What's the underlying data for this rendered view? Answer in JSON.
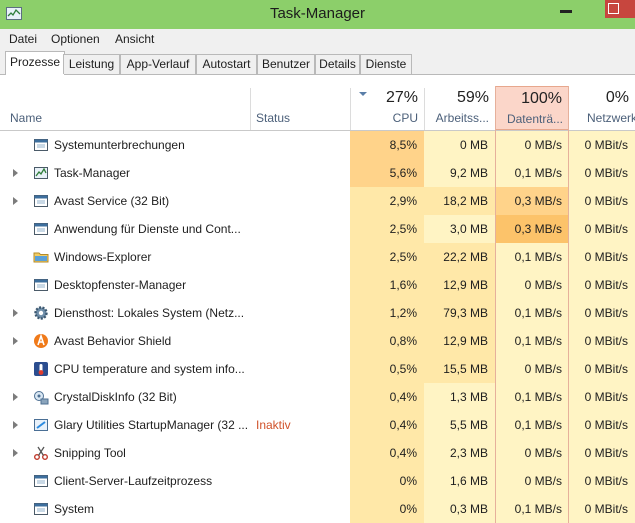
{
  "window": {
    "title": "Task-Manager"
  },
  "menu": [
    "Datei",
    "Optionen",
    "Ansicht"
  ],
  "tabs": [
    "Prozesse",
    "Leistung",
    "App-Verlauf",
    "Autostart",
    "Benutzer",
    "Details",
    "Dienste"
  ],
  "active_tab": "Prozesse",
  "header": {
    "name": "Name",
    "status": "Status",
    "cpu": {
      "percent": "27%",
      "label": "CPU"
    },
    "memory": {
      "percent": "59%",
      "label": "Arbeitss..."
    },
    "disk": {
      "percent": "100%",
      "label": "Datenträ..."
    },
    "network": {
      "percent": "0%",
      "label": "Netzwerk"
    }
  },
  "colors": {
    "titlebar": "#8ccf6a",
    "heat_light": "#fff4c4",
    "heat_medium": "#ffe8a8",
    "heat_strong": "#ffd38a",
    "heat_hot": "#fcc36a",
    "disk_header": "#fbd6c9",
    "status_inactive": "#d0522a"
  },
  "processes": [
    {
      "name": "Systemunterbrechungen",
      "expandable": false,
      "icon": "system-window-icon",
      "status": "",
      "cpu": "8,5%",
      "memory": "0 MB",
      "disk": "0 MB/s",
      "network": "0 MBit/s",
      "cpu_heat": 2,
      "mem_heat": 0,
      "disk_heat": 0
    },
    {
      "name": "Task-Manager",
      "expandable": true,
      "icon": "task-manager-icon",
      "status": "",
      "cpu": "5,6%",
      "memory": "9,2 MB",
      "disk": "0,1 MB/s",
      "network": "0 MBit/s",
      "cpu_heat": 2,
      "mem_heat": 0,
      "disk_heat": 0
    },
    {
      "name": "Avast Service (32 Bit)",
      "expandable": true,
      "icon": "system-window-icon",
      "status": "",
      "cpu": "2,9%",
      "memory": "18,2 MB",
      "disk": "0,3 MB/s",
      "network": "0 MBit/s",
      "cpu_heat": 1,
      "mem_heat": 1,
      "disk_heat": 2
    },
    {
      "name": "Anwendung für Dienste und Cont...",
      "expandable": false,
      "icon": "system-window-icon",
      "status": "",
      "cpu": "2,5%",
      "memory": "3,0 MB",
      "disk": "0,3 MB/s",
      "network": "0 MBit/s",
      "cpu_heat": 1,
      "mem_heat": 0,
      "disk_heat": 3
    },
    {
      "name": "Windows-Explorer",
      "expandable": false,
      "icon": "folder-icon",
      "status": "",
      "cpu": "2,5%",
      "memory": "22,2 MB",
      "disk": "0,1 MB/s",
      "network": "0 MBit/s",
      "cpu_heat": 1,
      "mem_heat": 1,
      "disk_heat": 0
    },
    {
      "name": "Desktopfenster-Manager",
      "expandable": false,
      "icon": "system-window-icon",
      "status": "",
      "cpu": "1,6%",
      "memory": "12,9 MB",
      "disk": "0 MB/s",
      "network": "0 MBit/s",
      "cpu_heat": 1,
      "mem_heat": 1,
      "disk_heat": 0
    },
    {
      "name": "Diensthost: Lokales System (Netz...",
      "expandable": true,
      "icon": "gear-icon",
      "status": "",
      "cpu": "1,2%",
      "memory": "79,3 MB",
      "disk": "0,1 MB/s",
      "network": "0 MBit/s",
      "cpu_heat": 1,
      "mem_heat": 1,
      "disk_heat": 0
    },
    {
      "name": "Avast Behavior Shield",
      "expandable": true,
      "icon": "avast-icon",
      "status": "",
      "cpu": "0,8%",
      "memory": "12,9 MB",
      "disk": "0,1 MB/s",
      "network": "0 MBit/s",
      "cpu_heat": 1,
      "mem_heat": 1,
      "disk_heat": 0
    },
    {
      "name": "CPU temperature and system info...",
      "expandable": false,
      "icon": "cpu-temp-icon",
      "status": "",
      "cpu": "0,5%",
      "memory": "15,5 MB",
      "disk": "0 MB/s",
      "network": "0 MBit/s",
      "cpu_heat": 1,
      "mem_heat": 1,
      "disk_heat": 0
    },
    {
      "name": "CrystalDiskInfo (32 Bit)",
      "expandable": true,
      "icon": "crystal-disk-icon",
      "status": "",
      "cpu": "0,4%",
      "memory": "1,3 MB",
      "disk": "0,1 MB/s",
      "network": "0 MBit/s",
      "cpu_heat": 1,
      "mem_heat": 0,
      "disk_heat": 0
    },
    {
      "name": "Glary Utilities StartupManager (32 ...",
      "expandable": true,
      "icon": "glary-icon",
      "status": "Inaktiv",
      "cpu": "0,4%",
      "memory": "5,5 MB",
      "disk": "0,1 MB/s",
      "network": "0 MBit/s",
      "cpu_heat": 1,
      "mem_heat": 0,
      "disk_heat": 0
    },
    {
      "name": "Snipping Tool",
      "expandable": true,
      "icon": "scissors-icon",
      "status": "",
      "cpu": "0,4%",
      "memory": "2,3 MB",
      "disk": "0 MB/s",
      "network": "0 MBit/s",
      "cpu_heat": 1,
      "mem_heat": 0,
      "disk_heat": 0
    },
    {
      "name": "Client-Server-Laufzeitprozess",
      "expandable": false,
      "icon": "system-window-icon",
      "status": "",
      "cpu": "0%",
      "memory": "1,6 MB",
      "disk": "0 MB/s",
      "network": "0 MBit/s",
      "cpu_heat": 1,
      "mem_heat": 0,
      "disk_heat": 0
    },
    {
      "name": "System",
      "expandable": false,
      "icon": "system-window-icon",
      "status": "",
      "cpu": "0%",
      "memory": "0,3 MB",
      "disk": "0,1 MB/s",
      "network": "0 MBit/s",
      "cpu_heat": 1,
      "mem_heat": 0,
      "disk_heat": 0
    }
  ]
}
